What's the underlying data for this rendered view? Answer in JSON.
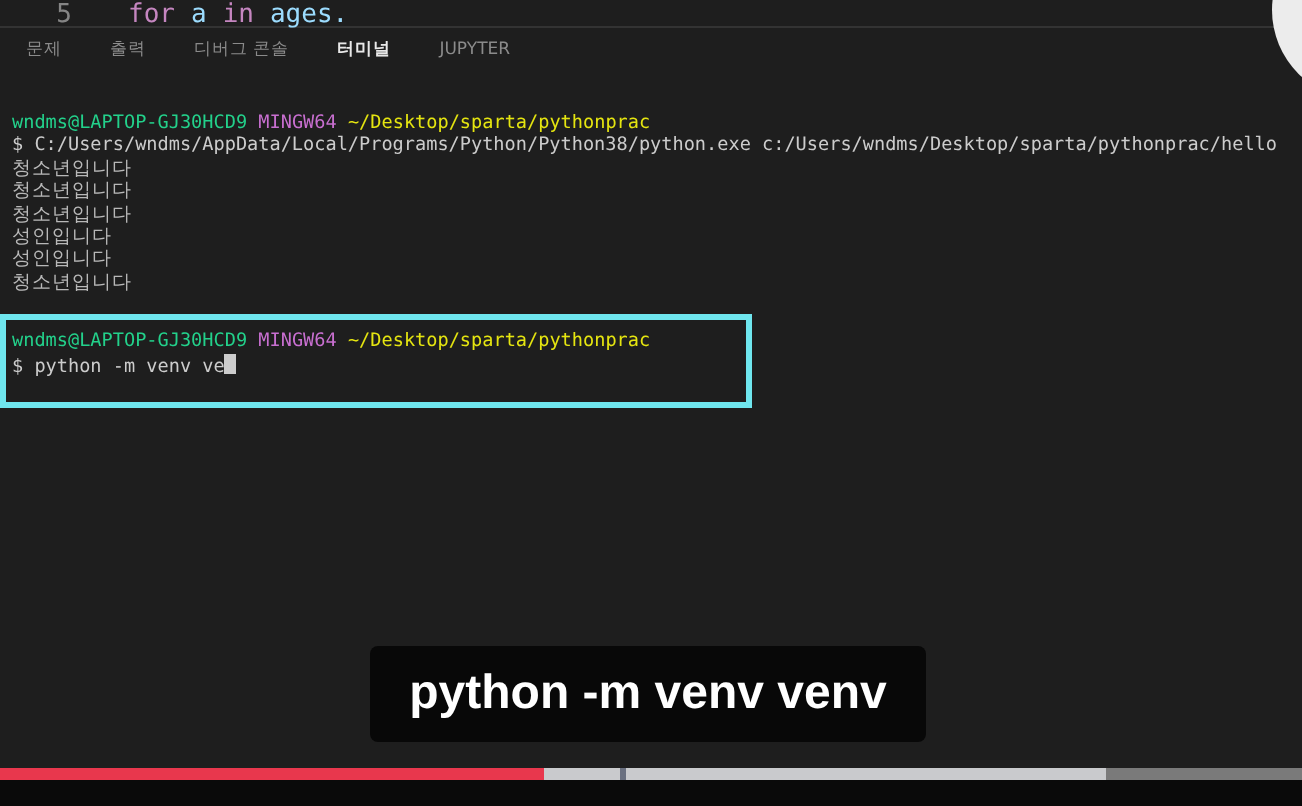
{
  "editor": {
    "line_number": "5",
    "tokens": [
      {
        "text": "for",
        "kind": "keyword"
      },
      {
        "text": "a",
        "kind": "variable"
      },
      {
        "text": "in",
        "kind": "keyword"
      },
      {
        "text": "ages.",
        "kind": "variable"
      }
    ]
  },
  "panel_tabs": [
    {
      "label": "문제",
      "selected": false
    },
    {
      "label": "출력",
      "selected": false
    },
    {
      "label": "디버그 콘솔",
      "selected": false
    },
    {
      "label": "터미널",
      "selected": true
    },
    {
      "label": "JUPYTER",
      "selected": false
    }
  ],
  "terminal": {
    "blocks": [
      {
        "highlighted": false,
        "lines": [
          {
            "kind": "prompt",
            "user": "wndms@LAPTOP-GJ30HCD9",
            "env": "MINGW64",
            "path": "~/Desktop/sparta/pythonprac"
          },
          {
            "kind": "command",
            "text": "$ C:/Users/wndms/AppData/Local/Programs/Python/Python38/python.exe c:/Users/wndms/Desktop/sparta/pythonprac/hello"
          },
          {
            "kind": "output",
            "text": "청소년입니다"
          },
          {
            "kind": "output",
            "text": "청소년입니다"
          },
          {
            "kind": "output",
            "text": "청소년입니다"
          },
          {
            "kind": "output",
            "text": "성인입니다"
          },
          {
            "kind": "output",
            "text": "성인입니다"
          },
          {
            "kind": "output",
            "text": "청소년입니다"
          }
        ]
      },
      {
        "highlighted": true,
        "lines": [
          {
            "kind": "prompt",
            "user": "wndms@LAPTOP-GJ30HCD9",
            "env": "MINGW64",
            "path": "~/Desktop/sparta/pythonprac"
          },
          {
            "kind": "input",
            "text": "$ python -m venv ve"
          }
        ]
      }
    ]
  },
  "caption": {
    "text": "python -m venv venv"
  },
  "player": {
    "progress": {
      "level": 0.418
    },
    "buffered": {
      "level": 0.85
    }
  }
}
